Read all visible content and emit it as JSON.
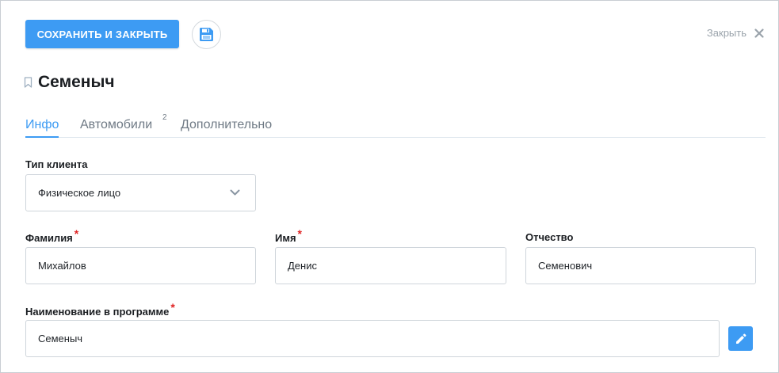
{
  "toolbar": {
    "save_close_label": "СОХРАНИТЬ И ЗАКРЫТЬ",
    "close_label": "Закрыть"
  },
  "page": {
    "title": "Семеныч"
  },
  "tabs": [
    {
      "label": "Инфо",
      "active": true,
      "badge": ""
    },
    {
      "label": "Автомобили",
      "active": false,
      "badge": "2"
    },
    {
      "label": "Дополнительно",
      "active": false,
      "badge": ""
    }
  ],
  "form": {
    "client_type": {
      "label": "Тип клиента",
      "value": "Физическое лицо"
    },
    "last_name": {
      "label": "Фамилия",
      "value": "Михайлов",
      "required": "*"
    },
    "first_name": {
      "label": "Имя",
      "value": "Денис",
      "required": "*"
    },
    "patronymic": {
      "label": "Отчество",
      "value": "Семенович"
    },
    "program_name": {
      "label": "Наименование в программе",
      "value": "Семеныч",
      "required": "*"
    }
  },
  "colors": {
    "accent": "#3d9bf3",
    "required": "#e02424",
    "muted": "#9aa3ab"
  },
  "icons": [
    "save-icon",
    "close-icon",
    "bookmark-icon",
    "chevron-down-icon",
    "pencil-icon"
  ]
}
